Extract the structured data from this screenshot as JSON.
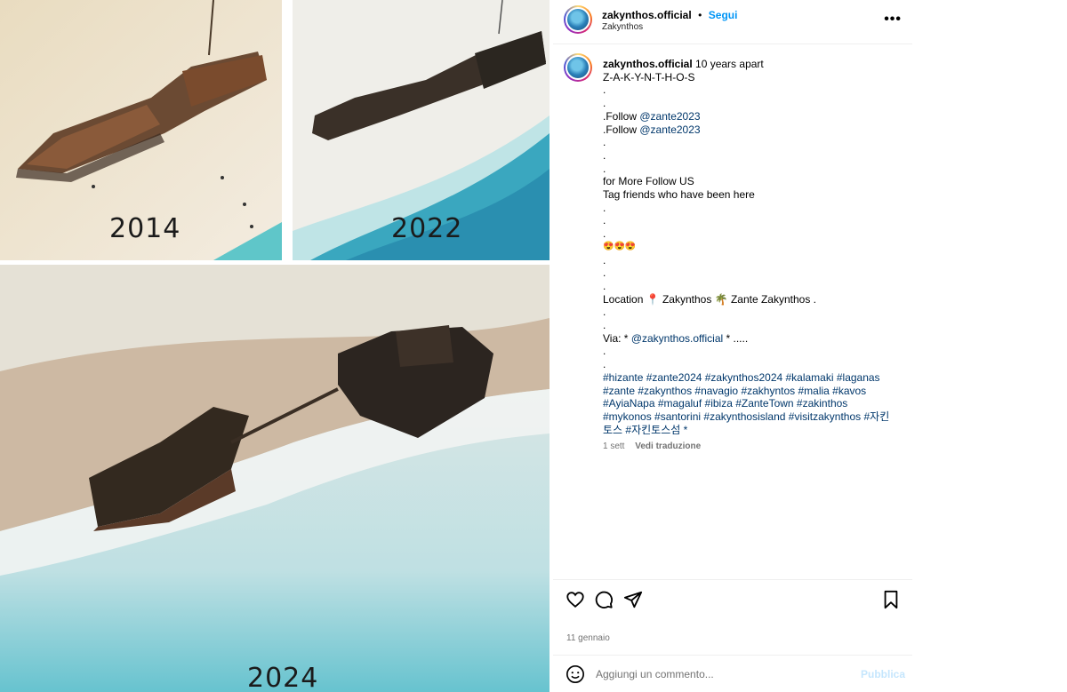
{
  "media": {
    "panels": [
      {
        "year": "2014"
      },
      {
        "year": "2022"
      },
      {
        "year": "2024"
      }
    ]
  },
  "header": {
    "username": "zakynthos.official",
    "separator": "•",
    "follow_label": "Segui",
    "location": "Zakynthos",
    "more_icon": "more-horizontal-icon"
  },
  "caption": {
    "username": "zakynthos.official",
    "lines": [
      "10 years apart",
      "Z-A-K-Y-N-T-H-O-S",
      ".",
      ".",
      ".Follow ",
      ".Follow ",
      ".",
      ".",
      ".",
      "for More Follow US",
      "Tag friends who have been here",
      ".",
      ".",
      ".",
      "😍😍😍",
      ".",
      ".",
      ".",
      "Location 📍 Zakynthos 🌴 Zante Zakynthos .",
      ".",
      ".",
      "Via: * ",
      ".",
      "."
    ],
    "mention_1": "@zante2023",
    "mention_2": "@zante2023",
    "via_mention": "@zakynthos.official",
    "via_tail": " * .....",
    "hashtag_lines": [
      "#hizante #zante2024 #zakynthos2024 #kalamaki #laganas",
      "#zante #zakynthos #navagio #zakhyntos #malia #kavos",
      "#AyiaNapa #magaluf #ibiza #ZanteTown #zakinthos",
      "#mykonos #santorini #zakynthosisland #visitzakynthos #자킨",
      "토스 #자킨토스섬 *"
    ]
  },
  "meta": {
    "age": "1 sett",
    "translate_label": "Vedi traduzione"
  },
  "actions": {
    "like_icon": "heart-icon",
    "comment_icon": "comment-icon",
    "share_icon": "send-icon",
    "save_icon": "bookmark-icon"
  },
  "date": "11 gennaio",
  "comment_box": {
    "emoji_icon": "emoji-icon",
    "placeholder": "Aggiungi un commento...",
    "post_label": "Pubblica"
  },
  "colors": {
    "accent": "#0095f6",
    "link": "#00376b",
    "muted": "#737373",
    "border": "#efefef"
  }
}
